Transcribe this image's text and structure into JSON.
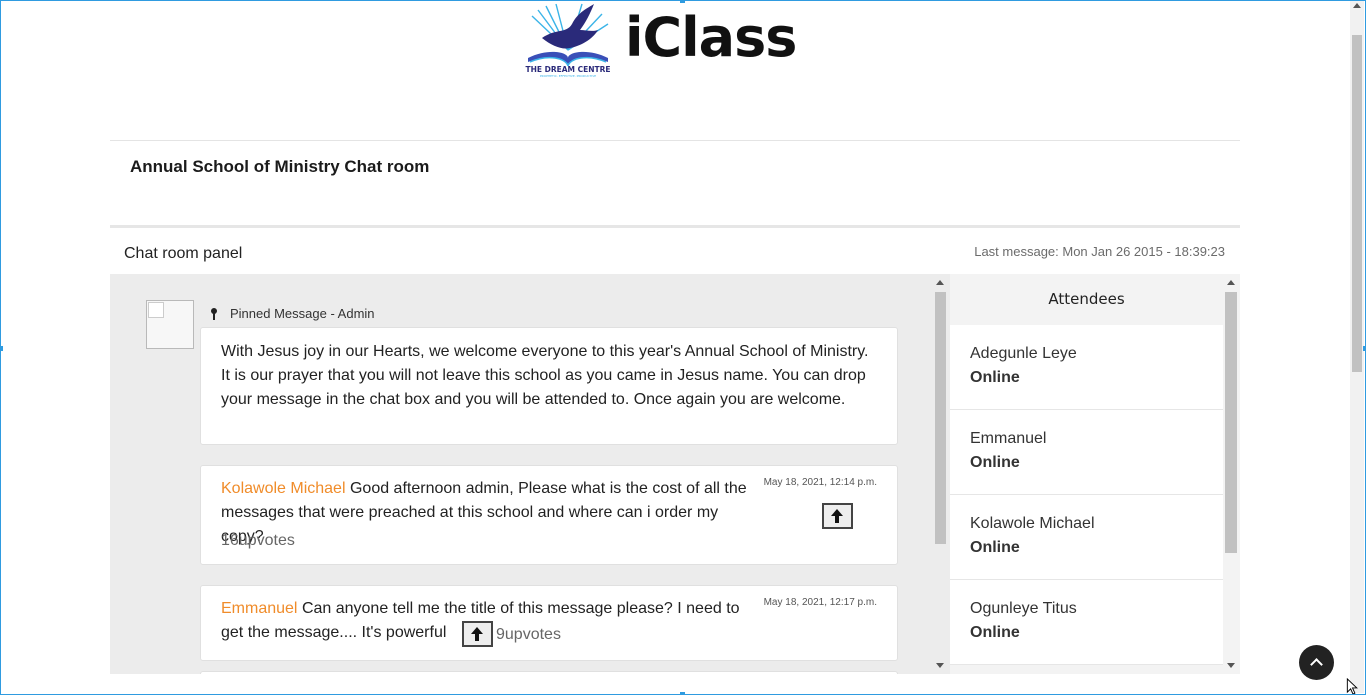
{
  "brand": {
    "name": "iClass",
    "logo_text": "THE DREAM CENTRE",
    "logo_tagline": "PROPHETIC. EFFECTIVE. PRODUCTIVE",
    "accent_color": "#f08c2a"
  },
  "room": {
    "title": "Annual School of Ministry Chat room"
  },
  "panel": {
    "title": "Chat room panel",
    "last_message": "Last message: Mon Jan 26 2015 - 18:39:23"
  },
  "pinned": {
    "label": "Pinned Message - Admin",
    "text": "With Jesus joy in our Hearts, we welcome everyone to this year's Annual School of Ministry. It is our prayer that you will not leave this school as you came in Jesus name. You can drop your message in the chat box and you will be attended to. Once again you are welcome."
  },
  "messages": [
    {
      "author": "Kolawole Michael",
      "text": "Good afternoon admin, Please what is the cost of all the messages that were preached at this school and where can i order my copy?",
      "timestamp": "May 18, 2021, 12:14 p.m.",
      "upvotes": "16upvotes"
    },
    {
      "author": "Emmanuel",
      "text": "Can anyone tell me the title of this message please? I need to get the message.... It's powerful",
      "timestamp": "May 18, 2021, 12:17 p.m.",
      "upvotes": "9upvotes"
    }
  ],
  "attendees": {
    "title": "Attendees",
    "items": [
      {
        "name": "Adegunle Leye",
        "status": "Online"
      },
      {
        "name": "Emmanuel",
        "status": "Online"
      },
      {
        "name": "Kolawole Michael",
        "status": "Online"
      },
      {
        "name": "Ogunleye Titus",
        "status": "Online"
      }
    ]
  },
  "icons": {
    "pin": "pin-icon",
    "upvote": "arrow-up-icon",
    "scroll_top": "chevron-up-icon"
  }
}
